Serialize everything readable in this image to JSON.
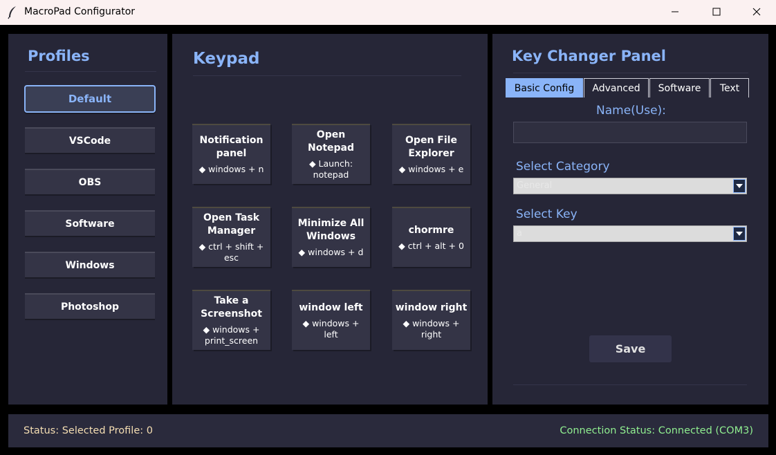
{
  "window": {
    "title": "MacroPad Configurator",
    "icon": "feather-icon"
  },
  "profiles": {
    "heading": "Profiles",
    "items": [
      {
        "label": "Default",
        "active": true
      },
      {
        "label": "VSCode"
      },
      {
        "label": "OBS"
      },
      {
        "label": "Software"
      },
      {
        "label": "Windows"
      },
      {
        "label": "Photoshop"
      }
    ]
  },
  "keypad": {
    "heading": "Keypad",
    "keys": [
      {
        "name": "Notification panel",
        "combo": "◆ windows + n"
      },
      {
        "name": "Open Notepad",
        "combo": "◆ Launch: notepad"
      },
      {
        "name": "Open File Explorer",
        "combo": "◆ windows + e"
      },
      {
        "name": "Open Task Manager",
        "combo": "◆ ctrl + shift + esc"
      },
      {
        "name": "Minimize All Windows",
        "combo": "◆ windows + d"
      },
      {
        "name": "chormre",
        "combo": "◆ ctrl + alt + 0"
      },
      {
        "name": "Take a Screenshot",
        "combo": "◆ windows + print_screen"
      },
      {
        "name": "window left",
        "combo": "◆ windows + left"
      },
      {
        "name": "window right",
        "combo": "◆ windows + right"
      }
    ]
  },
  "changer": {
    "heading": "Key Changer Panel",
    "tabs": [
      "Basic Config",
      "Advanced",
      "Software",
      "Text"
    ],
    "active_tab": "Basic Config",
    "name_label": "Name(Use):",
    "name_value": "",
    "category_label": "Select Category",
    "category_value": "General",
    "key_label": "Select Key",
    "key_value": "a",
    "save_label": "Save"
  },
  "status": {
    "left": "Status: Selected Profile: 0",
    "right": "Connection Status: Connected (COM3)"
  },
  "colors": {
    "accent": "#8ab4f8",
    "panel": "#262637",
    "status_left": "#f5deb3",
    "status_right": "#90ee90"
  }
}
